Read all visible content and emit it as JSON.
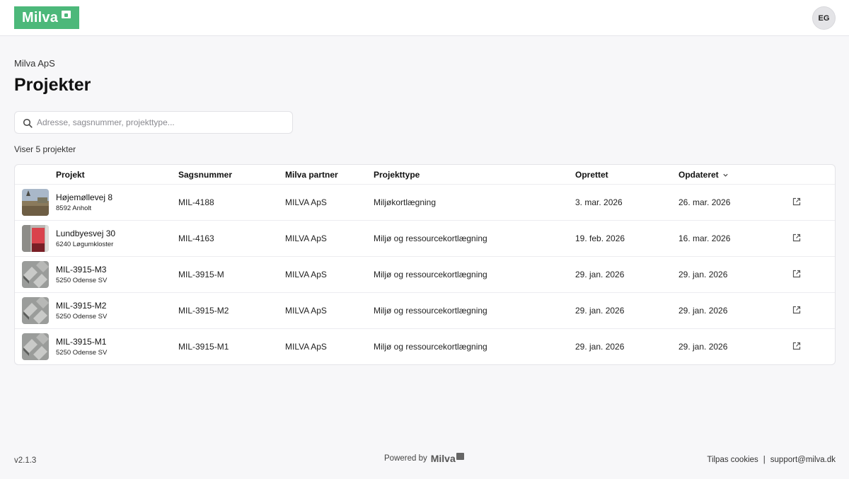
{
  "brand": {
    "name": "Milva",
    "color": "#4cb87a"
  },
  "user": {
    "initials": "EG"
  },
  "organization": "Milva ApS",
  "page_title": "Projekter",
  "search": {
    "placeholder": "Adresse, sagsnummer, projekttype...",
    "value": ""
  },
  "result_count": "Viser 5 projekter",
  "table": {
    "columns": {
      "project": "Projekt",
      "case_number": "Sagsnummer",
      "partner": "Milva partner",
      "project_type": "Projekttype",
      "created": "Oprettet",
      "updated": "Opdateret"
    },
    "sort_icon": "chevron-down-icon",
    "rows": [
      {
        "name": "Højemøllevej 8",
        "address": "8592 Anholt",
        "case_number": "MIL-4188",
        "partner": "MILVA ApS",
        "project_type": "Miljøkortlægning",
        "created": "3. mar. 2026",
        "updated": "26. mar. 2026",
        "thumb": "field-photo"
      },
      {
        "name": "Lundbyesvej 30",
        "address": "6240 Løgumkloster",
        "case_number": "MIL-4163",
        "partner": "MILVA ApS",
        "project_type": "Miljø og ressourcekortlægning",
        "created": "19. feb. 2026",
        "updated": "16. mar. 2026",
        "thumb": "building-photo"
      },
      {
        "name": "MIL-3915-M3",
        "address": "5250 Odense SV",
        "case_number": "MIL-3915-M",
        "partner": "MILVA ApS",
        "project_type": "Miljø og ressourcekortlægning",
        "created": "29. jan. 2026",
        "updated": "29. jan. 2026",
        "thumb": "aerial-photo"
      },
      {
        "name": "MIL-3915-M2",
        "address": "5250 Odense SV",
        "case_number": "MIL-3915-M2",
        "partner": "MILVA ApS",
        "project_type": "Miljø og ressourcekortlægning",
        "created": "29. jan. 2026",
        "updated": "29. jan. 2026",
        "thumb": "aerial-photo"
      },
      {
        "name": "MIL-3915-M1",
        "address": "5250 Odense SV",
        "case_number": "MIL-3915-M1",
        "partner": "MILVA ApS",
        "project_type": "Miljø og ressourcekortlægning",
        "created": "29. jan. 2026",
        "updated": "29. jan. 2026",
        "thumb": "aerial-photo"
      }
    ]
  },
  "footer": {
    "version": "v2.1.3",
    "powered_by": "Powered by",
    "powered_brand": "Milva",
    "cookies": "Tilpas cookies",
    "separator": "|",
    "support_email": "support@milva.dk"
  }
}
